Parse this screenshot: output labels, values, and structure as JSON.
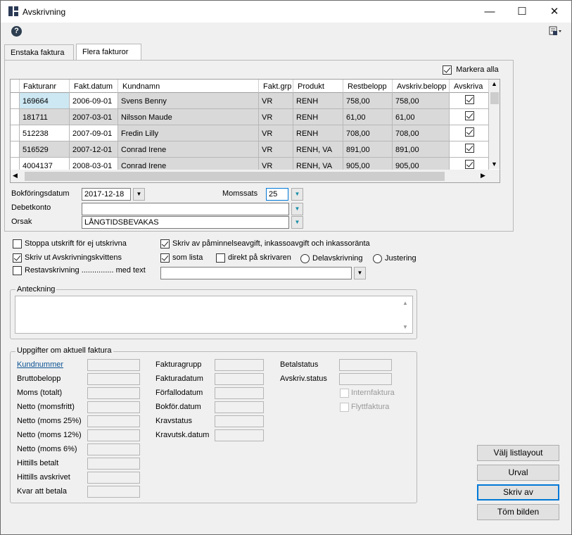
{
  "window": {
    "title": "Avskrivning",
    "minimize": "—",
    "maximize": "☐",
    "close": "✕"
  },
  "toolbar": {
    "help": "?"
  },
  "tabs": [
    {
      "label": "Enstaka faktura"
    },
    {
      "label": "Flera fakturor"
    }
  ],
  "mark_all": {
    "label": "Markera alla",
    "checked": true
  },
  "grid": {
    "columns": [
      "Fakturanr",
      "Fakt.datum",
      "Kundnamn",
      "Fakt.grp",
      "Produkt",
      "Restbelopp",
      "Avskriv.belopp",
      "Avskriva"
    ],
    "rows": [
      {
        "fakturanr": "169664",
        "datum": "2006-09-01",
        "kund": "Svens Benny",
        "grp": "VR",
        "produkt": "RENH",
        "rest": "758,00",
        "avskriv": "758,00",
        "checked": true
      },
      {
        "fakturanr": "181711",
        "datum": "2007-03-01",
        "kund": "Nilsson Maude",
        "grp": "VR",
        "produkt": "RENH",
        "rest": "61,00",
        "avskriv": "61,00",
        "checked": true
      },
      {
        "fakturanr": "512238",
        "datum": "2007-09-01",
        "kund": "Fredin Lilly",
        "grp": "VR",
        "produkt": "RENH",
        "rest": "708,00",
        "avskriv": "708,00",
        "checked": true
      },
      {
        "fakturanr": "516529",
        "datum": "2007-12-01",
        "kund": "Conrad Irene",
        "grp": "VR",
        "produkt": "RENH, VA",
        "rest": "891,00",
        "avskriv": "891,00",
        "checked": true
      },
      {
        "fakturanr": "4004137",
        "datum": "2008-03-01",
        "kund": "Conrad Irene",
        "grp": "VR",
        "produkt": "RENH, VA",
        "rest": "905,00",
        "avskriv": "905,00",
        "checked": true
      }
    ]
  },
  "form": {
    "bokforingsdatum_label": "Bokföringsdatum",
    "bokforingsdatum_value": "2017-12-18",
    "momssats_label": "Momssats",
    "momssats_value": "25",
    "debetkonto_label": "Debetkonto",
    "debetkonto_value": "",
    "orsak_label": "Orsak",
    "orsak_value": "LÅNGTIDSBEVAKAS"
  },
  "options": {
    "stoppa": "Stoppa utskrift för ej utskrivna",
    "skriv_kvittens": "Skriv ut Avskrivningskvittens",
    "restavskrivning": "Restavskrivning ............... med text",
    "skriv_av_paminn": "Skriv av påminnelseavgift, inkassoavgift och inkassoränta",
    "som_lista": "som lista",
    "direkt": "direkt på skrivaren",
    "delavskrivning": "Delavskrivning",
    "justering": "Justering"
  },
  "anteckning": {
    "legend": "Anteckning",
    "text": ""
  },
  "uppgifter": {
    "legend": "Uppgifter om aktuell faktura",
    "col1": [
      "Kundnummer",
      "Bruttobelopp",
      "Moms (totalt)",
      "Netto (momsfritt)",
      "Netto (moms 25%)",
      "Netto (moms 12%)",
      "Netto (moms 6%)",
      "Hittills betalt",
      "Hittills avskrivet",
      "Kvar att betala"
    ],
    "col2": [
      "Fakturagrupp",
      "Fakturadatum",
      "Förfallodatum",
      "Bokför.datum",
      "Kravstatus",
      "Kravutsk.datum"
    ],
    "col3": [
      "Betalstatus",
      "Avskriv.status"
    ],
    "internfaktura": "Internfaktura",
    "flyttfaktura": "Flyttfaktura"
  },
  "buttons": {
    "listlayout": "Välj listlayout",
    "urval": "Urval",
    "skriv_av": "Skriv av",
    "tom": "Töm bilden"
  },
  "colors": {
    "selected_cell": "#cde8f3",
    "grid_row": "#d9d9d9",
    "accent": "#0078d7"
  }
}
